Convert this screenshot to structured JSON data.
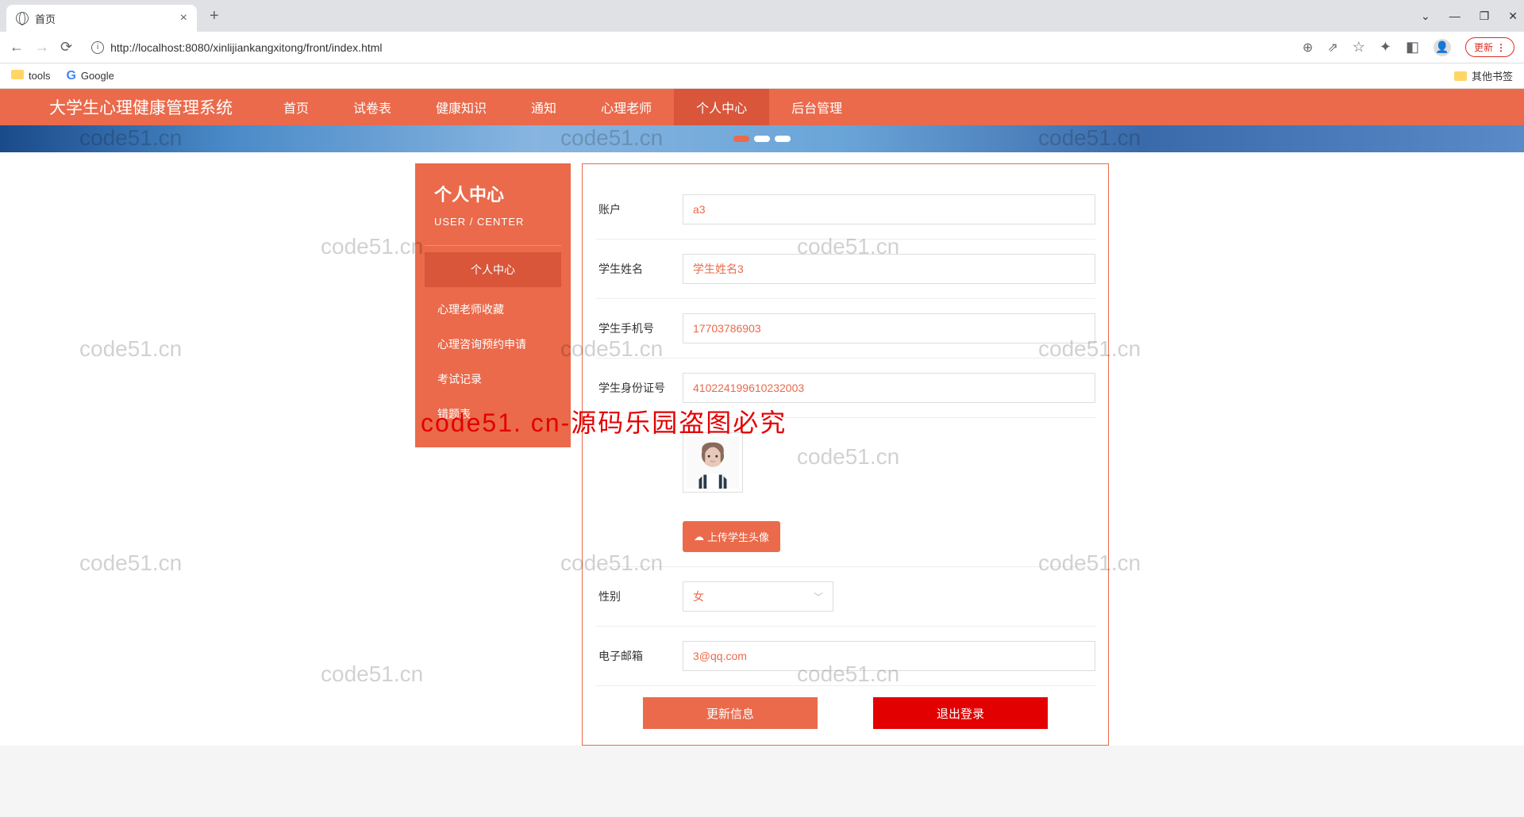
{
  "browser": {
    "tab_title": "首页",
    "url": "http://localhost:8080/xinlijiankangxitong/front/index.html",
    "update_label": "更新",
    "bookmarks": {
      "tools": "tools",
      "google": "Google",
      "other": "其他书签"
    }
  },
  "topnav": {
    "brand": "大学生心理健康管理系统",
    "items": [
      "首页",
      "试卷表",
      "健康知识",
      "通知",
      "心理老师",
      "个人中心",
      "后台管理"
    ],
    "active_index": 5
  },
  "sidebar": {
    "title": "个人中心",
    "subtitle": "USER / CENTER",
    "items": [
      "个人中心",
      "心理老师收藏",
      "心理咨询预约申请",
      "考试记录",
      "错题表"
    ],
    "active_index": 0
  },
  "form": {
    "account_label": "账户",
    "account_value": "a3",
    "name_label": "学生姓名",
    "name_value": "学生姓名3",
    "phone_label": "学生手机号",
    "phone_value": "17703786903",
    "idcard_label": "学生身份证号",
    "idcard_value": "410224199610232003",
    "upload_label": "上传学生头像",
    "gender_label": "性别",
    "gender_value": "女",
    "email_label": "电子邮箱",
    "email_value": "3@qq.com",
    "update_btn": "更新信息",
    "logout_btn": "退出登录"
  },
  "watermarks": {
    "text": "code51.cn",
    "main": "code51. cn-源码乐园盗图必究"
  }
}
